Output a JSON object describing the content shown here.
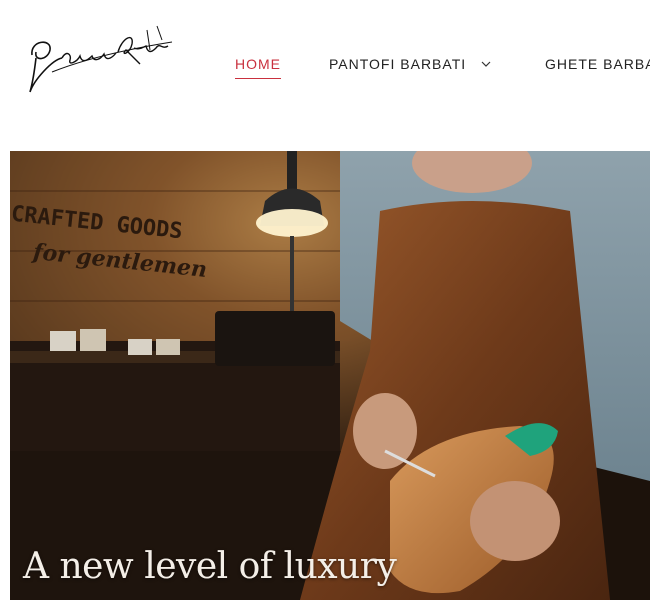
{
  "brand": {
    "logo_text": "GregorioRiza"
  },
  "nav": {
    "items": [
      {
        "label": "HOME",
        "active": true
      },
      {
        "label": "PANTOFI BARBATI",
        "has_dropdown": true
      },
      {
        "label": "GHETE BARBA"
      }
    ],
    "active_color": "#c9303e"
  },
  "hero": {
    "heading": "A new level of luxury",
    "sign_line1": "CRAFTED GOODS",
    "sign_line2": "for gentlemen"
  }
}
